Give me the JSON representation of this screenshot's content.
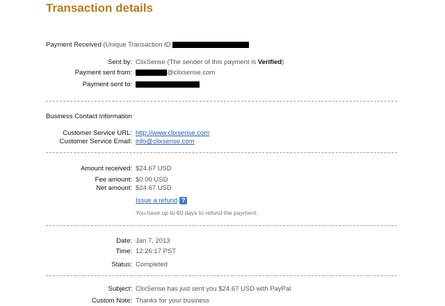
{
  "title": "Transaction details",
  "payment_received": {
    "label": "Payment Received",
    "suffix": "(Unique Transaction ID"
  },
  "sender": {
    "sent_by_label": "Sent by:",
    "sent_by_value": "ClixSense (The sender of this payment is ",
    "verified": "Verified",
    "close_paren": ")",
    "sent_from_label": "Payment sent from:",
    "sent_from_domain": "@clixsense.com",
    "sent_to_label": "Payment sent to:"
  },
  "business": {
    "heading": "Business Contact Information",
    "url_label": "Customer Service URL:",
    "url_value": "http://www.clixsense.com",
    "email_label": "Customer Service Email:",
    "email_value": "info@clixsense.com"
  },
  "amounts": {
    "received_label": "Amount received:",
    "received_value": "$24.67 USD",
    "fee_label": "Fee amount:",
    "fee_value": "$0.00 USD",
    "net_label": "Net amount:",
    "net_value": "$24.67 USD",
    "refund_link": "Issue a refund",
    "refund_note": "You have up to 60 days to refund the payment."
  },
  "details": {
    "date_label": "Date:",
    "date_value": "Jan 7, 2013",
    "time_label": "Time:",
    "time_value": "12:26:17 PST",
    "status_label": "Status:",
    "status_value": "Completed"
  },
  "message": {
    "subject_label": "Subject:",
    "subject_value": "ClixSense has just sent you $24.67 USD with PayPal",
    "note_label": "Custom Note:",
    "note_value": "Thanks for your business"
  },
  "colors": {
    "title": "#b77a1e",
    "link": "#2a5db0",
    "help_icon": "#3c7fc8"
  }
}
